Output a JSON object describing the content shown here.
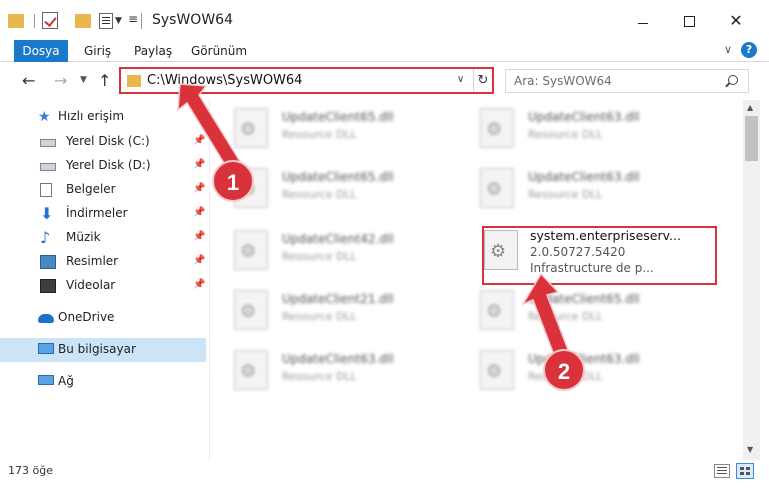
{
  "window": {
    "title": "SysWOW64",
    "close_glyph": "✕"
  },
  "ribbon": {
    "tabs": [
      "Dosya",
      "Giriş",
      "Paylaş",
      "Görünüm"
    ],
    "help": "?"
  },
  "nav": {
    "back": "←",
    "forward": "→",
    "up": "↑",
    "address": "C:\\Windows\\SysWOW64",
    "refresh": "↻",
    "search_placeholder": "Ara: SysWOW64"
  },
  "sidebar": {
    "quick_access": "Hızlı erişim",
    "items": [
      {
        "label": "Yerel Disk (C:)",
        "icon": "disk-icon"
      },
      {
        "label": "Yerel Disk (D:)",
        "icon": "disk-icon"
      },
      {
        "label": "Belgeler",
        "icon": "documents-icon"
      },
      {
        "label": "İndirmeler",
        "icon": "downloads-icon"
      },
      {
        "label": "Müzik",
        "icon": "music-icon"
      },
      {
        "label": "Resimler",
        "icon": "pictures-icon"
      },
      {
        "label": "Videolar",
        "icon": "videos-icon"
      }
    ],
    "onedrive": "OneDrive",
    "this_pc": "Bu bilgisayar",
    "network": "Ağ"
  },
  "files": [
    {
      "name": "UpdateClient65.dll",
      "type": "Resource DLL"
    },
    {
      "name": "UpdateClient63.dll",
      "type": "Resource DLL"
    },
    {
      "name": "UpdateClient65.dll",
      "type": "Resource DLL"
    },
    {
      "name": "UpdateClient63.dll",
      "type": "Resource DLL"
    },
    {
      "name": "UpdateClient42.dll",
      "type": "Resource DLL"
    },
    {
      "name": "UpdateClient21.dll",
      "type": "Resource DLL"
    },
    {
      "name": "UpdateClient65.dll",
      "type": "Resource DLL"
    },
    {
      "name": "UpdateClient63.dll",
      "type": "Resource DLL"
    },
    {
      "name": "UpdateClient63.dll",
      "type": "Resource DLL"
    }
  ],
  "target_file": {
    "name": "system.enterpriseserv...",
    "version": "2.0.50727.5420",
    "description": "Infrastructure de p..."
  },
  "status": {
    "item_count": "173 öğe"
  },
  "annotations": {
    "step1": "1",
    "step2": "2",
    "color": "#d9323a"
  }
}
